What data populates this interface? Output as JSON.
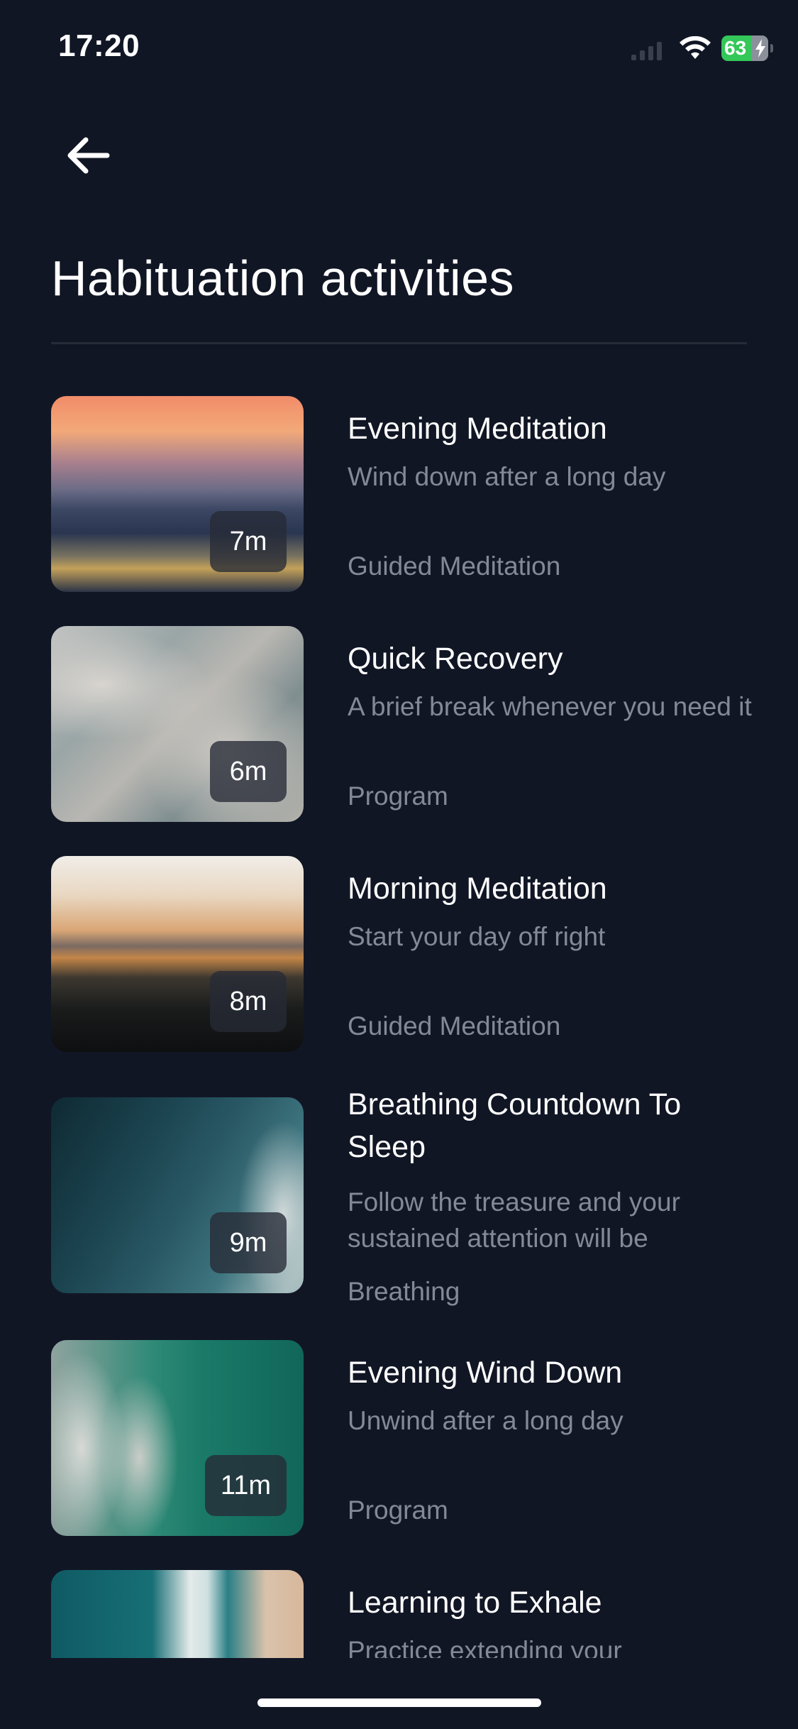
{
  "status_bar": {
    "time": "17:20",
    "battery": "63"
  },
  "header": {
    "title": "Habituation activities"
  },
  "activities": [
    {
      "title": "Evening Meditation",
      "subtitle": "Wind down after a long day",
      "category": "Guided Meditation",
      "duration": "7m"
    },
    {
      "title": "Quick Recovery",
      "subtitle": "A brief break whenever you need it",
      "category": "Program",
      "duration": "6m"
    },
    {
      "title": "Morning Meditation",
      "subtitle": "Start your day off right",
      "category": "Guided Meditation",
      "duration": "8m"
    },
    {
      "title": "Breathing Countdown To Sleep",
      "subtitle": "Follow the treasure and your sustained attention will be",
      "category": "Breathing",
      "duration": "9m"
    },
    {
      "title": "Evening Wind Down",
      "subtitle": "Unwind after a long day",
      "category": "Program",
      "duration": "11m"
    },
    {
      "title": "Learning to Exhale",
      "subtitle": "Practice extending your",
      "category": "",
      "duration": ""
    }
  ]
}
